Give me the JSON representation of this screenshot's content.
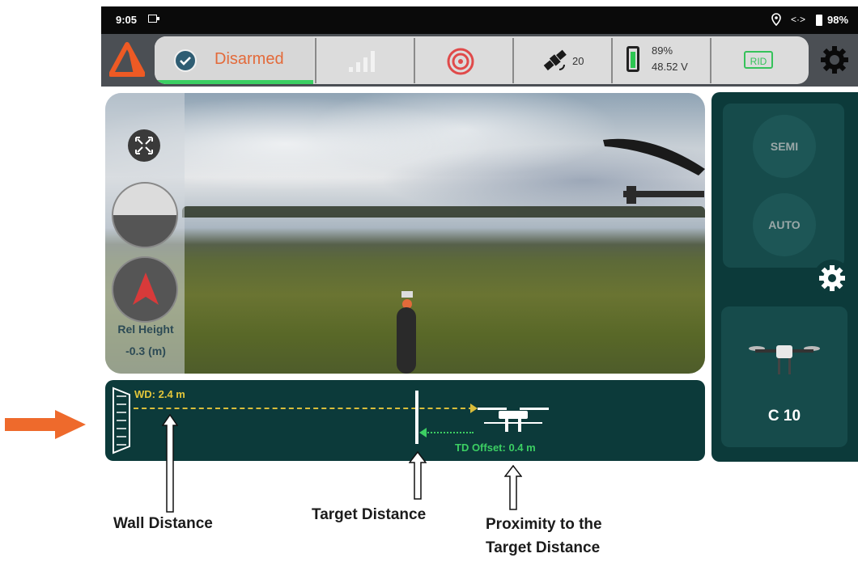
{
  "status_bar": {
    "time": "9:05",
    "sync": "<·>",
    "battery": "98%"
  },
  "toolbar": {
    "arm_status": "Disarmed",
    "satellite_count": "20",
    "battery_percent": "89%",
    "battery_voltage": "48.52 V",
    "rid_label": "RID",
    "colors": {
      "accent": "#e36a3a",
      "armed_bar": "#3ccf63",
      "rid": "#36c25a"
    }
  },
  "camera": {
    "rel_height_label": "Rel Height",
    "rel_height_value": "-0.3 (m)"
  },
  "distance_panel": {
    "wd_label": "WD: 2.4 m",
    "td_offset_label": "TD Offset: 0.4 m"
  },
  "side_panel": {
    "mode_semi": "SEMI",
    "mode_auto": "AUTO",
    "drone_name": "C 10"
  },
  "annotations": {
    "wall_distance": "Wall Distance",
    "target_distance": "Target Distance",
    "proximity_line1": "Proximity to the",
    "proximity_line2": "Target Distance"
  }
}
